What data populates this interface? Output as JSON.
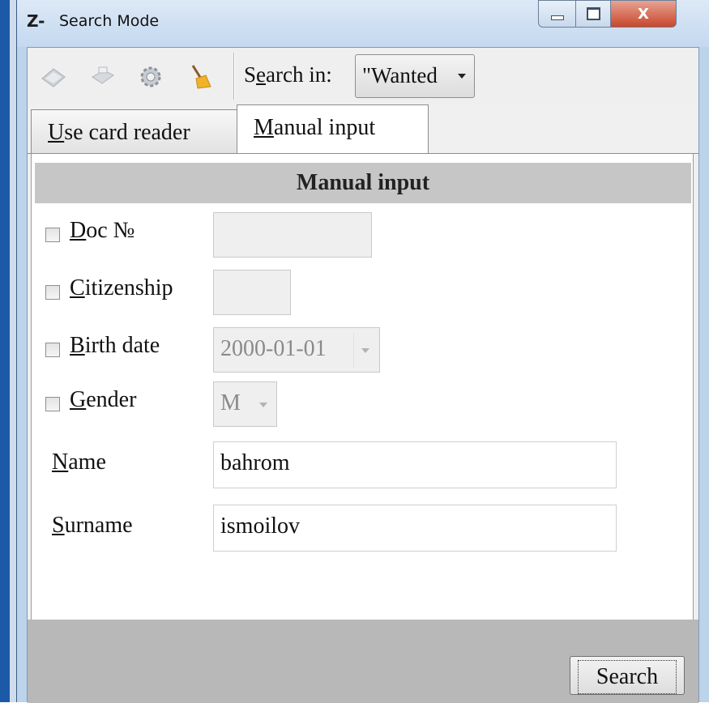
{
  "window": {
    "title": "Search Mode",
    "app_icon": "Z-",
    "close_glyph": "X"
  },
  "toolbar": {
    "icons": [
      "card-reader-icon",
      "printer-icon",
      "settings-gear-icon",
      "broom-clear-icon"
    ],
    "search_in_label_pre": "S",
    "search_in_label_ul": "e",
    "search_in_label_post": "arch in:",
    "search_in_value": "\"Wanted"
  },
  "tabs": {
    "card_reader": {
      "ul": "U",
      "rest": "se card reader"
    },
    "manual_input": {
      "ul": "M",
      "rest": "anual input"
    }
  },
  "panel": {
    "header": "Manual input",
    "doc_no": {
      "ul": "D",
      "rest": "oc №",
      "value": ""
    },
    "citizenship": {
      "ul": "C",
      "rest": "itizenship",
      "value": ""
    },
    "birth_date": {
      "ul": "B",
      "rest": "irth date",
      "value": "2000-01-01"
    },
    "gender": {
      "ul": "G",
      "rest": "ender",
      "value": "M"
    },
    "name": {
      "ul": "N",
      "rest": "ame",
      "value": "bahrom"
    },
    "surname": {
      "ul": "S",
      "rest": "urname",
      "value": "ismoilov"
    }
  },
  "footer": {
    "search_button": "Search"
  }
}
